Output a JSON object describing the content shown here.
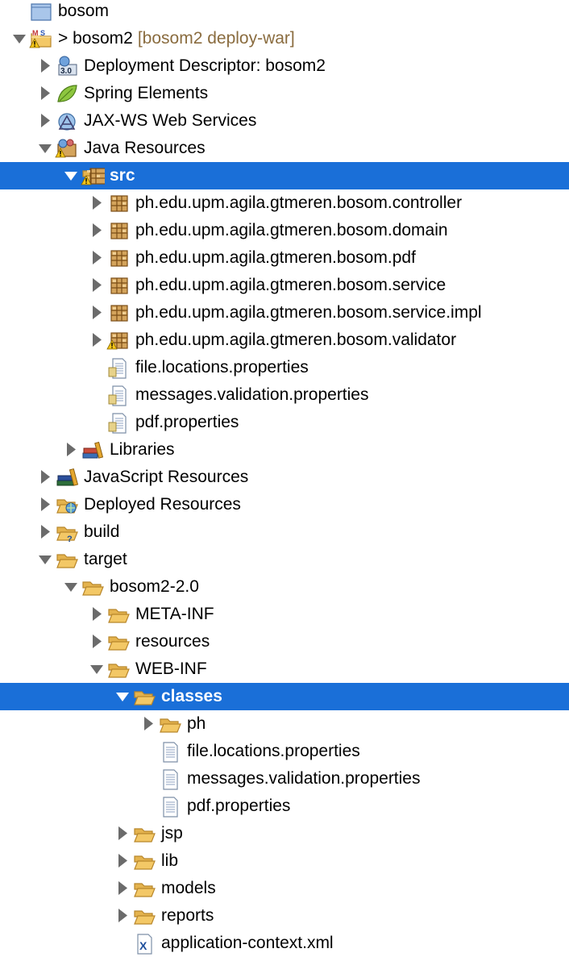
{
  "tree": [
    {
      "name": "project-bosom",
      "label": "bosom",
      "depth": 0,
      "twisty": "none",
      "icon": "project-folder-icon"
    },
    {
      "name": "project-bosom2",
      "label": "bosom2",
      "prefix": ">",
      "suffix": "[bosom2 deploy-war]",
      "depth": 0,
      "twisty": "down",
      "icon": "maven-project-icon"
    },
    {
      "name": "deployment-descriptor",
      "label": "Deployment Descriptor: bosom2",
      "depth": 1,
      "twisty": "right",
      "icon": "deployment-descriptor-icon"
    },
    {
      "name": "spring-elements",
      "label": "Spring Elements",
      "depth": 1,
      "twisty": "right",
      "icon": "spring-leaf-icon"
    },
    {
      "name": "jax-ws-web-services",
      "label": "JAX-WS Web Services",
      "depth": 1,
      "twisty": "right",
      "icon": "web-services-icon"
    },
    {
      "name": "java-resources",
      "label": "Java Resources",
      "depth": 1,
      "twisty": "down",
      "icon": "java-resources-icon"
    },
    {
      "name": "src",
      "label": "src",
      "depth": 2,
      "twisty": "down",
      "icon": "source-folder-warning-icon",
      "selected": true
    },
    {
      "name": "package-controller",
      "label": "ph.edu.upm.agila.gtmeren.bosom.controller",
      "depth": 3,
      "twisty": "right",
      "icon": "package-icon"
    },
    {
      "name": "package-domain",
      "label": "ph.edu.upm.agila.gtmeren.bosom.domain",
      "depth": 3,
      "twisty": "right",
      "icon": "package-icon"
    },
    {
      "name": "package-pdf",
      "label": "ph.edu.upm.agila.gtmeren.bosom.pdf",
      "depth": 3,
      "twisty": "right",
      "icon": "package-icon"
    },
    {
      "name": "package-service",
      "label": "ph.edu.upm.agila.gtmeren.bosom.service",
      "depth": 3,
      "twisty": "right",
      "icon": "package-icon"
    },
    {
      "name": "package-service-impl",
      "label": "ph.edu.upm.agila.gtmeren.bosom.service.impl",
      "depth": 3,
      "twisty": "right",
      "icon": "package-icon"
    },
    {
      "name": "package-validator",
      "label": "ph.edu.upm.agila.gtmeren.bosom.validator",
      "depth": 3,
      "twisty": "right",
      "icon": "package-warning-icon"
    },
    {
      "name": "src-file-locations-properties",
      "label": "file.locations.properties",
      "depth": 3,
      "twisty": "none",
      "icon": "properties-file-icon"
    },
    {
      "name": "src-messages-validation-properties",
      "label": "messages.validation.properties",
      "depth": 3,
      "twisty": "none",
      "icon": "properties-file-icon"
    },
    {
      "name": "src-pdf-properties",
      "label": "pdf.properties",
      "depth": 3,
      "twisty": "none",
      "icon": "properties-file-icon"
    },
    {
      "name": "libraries",
      "label": "Libraries",
      "depth": 2,
      "twisty": "right",
      "icon": "libraries-icon"
    },
    {
      "name": "javascript-resources",
      "label": "JavaScript Resources",
      "depth": 1,
      "twisty": "right",
      "icon": "javascript-resources-icon"
    },
    {
      "name": "deployed-resources",
      "label": "Deployed Resources",
      "depth": 1,
      "twisty": "right",
      "icon": "deployed-resources-icon"
    },
    {
      "name": "build",
      "label": "build",
      "depth": 1,
      "twisty": "right",
      "icon": "folder-unknown-icon"
    },
    {
      "name": "target",
      "label": "target",
      "depth": 1,
      "twisty": "down",
      "icon": "folder-open-icon"
    },
    {
      "name": "bosom2-2-0",
      "label": "bosom2-2.0",
      "depth": 2,
      "twisty": "down",
      "icon": "folder-open-icon"
    },
    {
      "name": "meta-inf",
      "label": "META-INF",
      "depth": 3,
      "twisty": "right",
      "icon": "folder-icon"
    },
    {
      "name": "resources",
      "label": "resources",
      "depth": 3,
      "twisty": "right",
      "icon": "folder-icon"
    },
    {
      "name": "web-inf",
      "label": "WEB-INF",
      "depth": 3,
      "twisty": "down",
      "icon": "folder-open-icon"
    },
    {
      "name": "classes",
      "label": "classes",
      "depth": 4,
      "twisty": "down",
      "icon": "folder-open-icon",
      "selected": true
    },
    {
      "name": "ph",
      "label": "ph",
      "depth": 5,
      "twisty": "right",
      "icon": "folder-icon"
    },
    {
      "name": "classes-file-locations-properties",
      "label": "file.locations.properties",
      "depth": 5,
      "twisty": "none",
      "icon": "text-file-icon"
    },
    {
      "name": "classes-messages-validation-properties",
      "label": "messages.validation.properties",
      "depth": 5,
      "twisty": "none",
      "icon": "text-file-icon"
    },
    {
      "name": "classes-pdf-properties",
      "label": "pdf.properties",
      "depth": 5,
      "twisty": "none",
      "icon": "text-file-icon"
    },
    {
      "name": "jsp",
      "label": "jsp",
      "depth": 4,
      "twisty": "right",
      "icon": "folder-icon"
    },
    {
      "name": "lib",
      "label": "lib",
      "depth": 4,
      "twisty": "right",
      "icon": "folder-icon"
    },
    {
      "name": "models",
      "label": "models",
      "depth": 4,
      "twisty": "right",
      "icon": "folder-icon"
    },
    {
      "name": "reports",
      "label": "reports",
      "depth": 4,
      "twisty": "right",
      "icon": "folder-icon"
    },
    {
      "name": "application-context-xml",
      "label": "application-context.xml",
      "depth": 4,
      "twisty": "none",
      "icon": "xml-file-icon"
    }
  ],
  "colors": {
    "selection": "#1a6fd8",
    "suffix_text": "#8a6c3f",
    "folder": "#f3c866",
    "twisty": "#6b6b6b"
  }
}
